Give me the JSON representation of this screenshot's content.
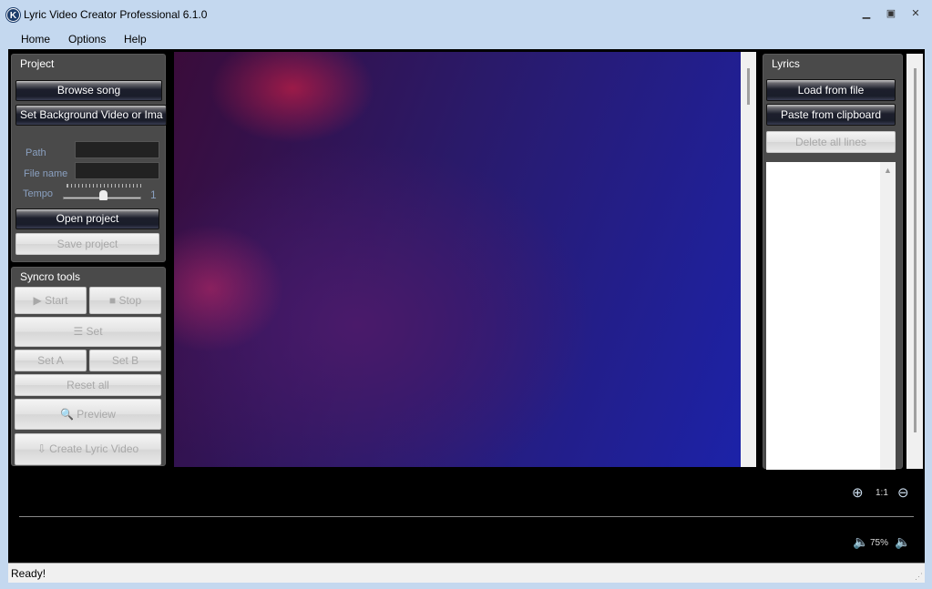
{
  "window": {
    "title": "Lyric Video Creator Professional 6.1.0",
    "icon": "K",
    "controls": [
      "minimize-icon",
      "maximize-icon",
      "close-icon"
    ]
  },
  "menu": [
    "Home",
    "Options",
    "Help"
  ],
  "project": {
    "title": "Project",
    "browse_song": "Browse song",
    "set_background": "Set Background Video or Ima",
    "path_label": "Path",
    "path_value": "",
    "filename_label": "File name",
    "filename_value": "",
    "tempo_label": "Tempo",
    "tempo_value": "1",
    "open_project": "Open project",
    "save_project": "Save project"
  },
  "syncro": {
    "title": "Syncro tools",
    "start": "Start",
    "stop": "Stop",
    "set": "Set",
    "set_a": "Set A",
    "set_b": "Set B",
    "reset_all": "Reset all",
    "preview": "Preview",
    "create": "Create Lyric Video"
  },
  "lyrics": {
    "title": "Lyrics",
    "load_file": "Load from file",
    "paste_clipboard": "Paste from clipboard",
    "delete_all": "Delete all lines"
  },
  "timeline": {
    "zoom_level": "1:1",
    "volume": "75%"
  },
  "status": {
    "text": "Ready!"
  },
  "colors": {
    "window": "#c4d8ef",
    "panel": "#4a4a4a",
    "background": "#000000"
  }
}
